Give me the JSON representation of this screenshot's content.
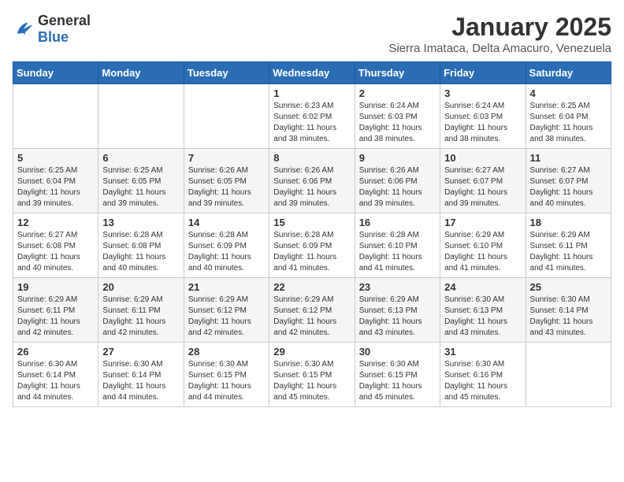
{
  "header": {
    "logo_general": "General",
    "logo_blue": "Blue",
    "title": "January 2025",
    "subtitle": "Sierra Imataca, Delta Amacuro, Venezuela"
  },
  "days_of_week": [
    "Sunday",
    "Monday",
    "Tuesday",
    "Wednesday",
    "Thursday",
    "Friday",
    "Saturday"
  ],
  "weeks": [
    [
      {
        "day": "",
        "info": ""
      },
      {
        "day": "",
        "info": ""
      },
      {
        "day": "",
        "info": ""
      },
      {
        "day": "1",
        "info": "Sunrise: 6:23 AM\nSunset: 6:02 PM\nDaylight: 11 hours and 38 minutes."
      },
      {
        "day": "2",
        "info": "Sunrise: 6:24 AM\nSunset: 6:03 PM\nDaylight: 11 hours and 38 minutes."
      },
      {
        "day": "3",
        "info": "Sunrise: 6:24 AM\nSunset: 6:03 PM\nDaylight: 11 hours and 38 minutes."
      },
      {
        "day": "4",
        "info": "Sunrise: 6:25 AM\nSunset: 6:04 PM\nDaylight: 11 hours and 38 minutes."
      }
    ],
    [
      {
        "day": "5",
        "info": "Sunrise: 6:25 AM\nSunset: 6:04 PM\nDaylight: 11 hours and 39 minutes."
      },
      {
        "day": "6",
        "info": "Sunrise: 6:25 AM\nSunset: 6:05 PM\nDaylight: 11 hours and 39 minutes."
      },
      {
        "day": "7",
        "info": "Sunrise: 6:26 AM\nSunset: 6:05 PM\nDaylight: 11 hours and 39 minutes."
      },
      {
        "day": "8",
        "info": "Sunrise: 6:26 AM\nSunset: 6:06 PM\nDaylight: 11 hours and 39 minutes."
      },
      {
        "day": "9",
        "info": "Sunrise: 6:26 AM\nSunset: 6:06 PM\nDaylight: 11 hours and 39 minutes."
      },
      {
        "day": "10",
        "info": "Sunrise: 6:27 AM\nSunset: 6:07 PM\nDaylight: 11 hours and 39 minutes."
      },
      {
        "day": "11",
        "info": "Sunrise: 6:27 AM\nSunset: 6:07 PM\nDaylight: 11 hours and 40 minutes."
      }
    ],
    [
      {
        "day": "12",
        "info": "Sunrise: 6:27 AM\nSunset: 6:08 PM\nDaylight: 11 hours and 40 minutes."
      },
      {
        "day": "13",
        "info": "Sunrise: 6:28 AM\nSunset: 6:08 PM\nDaylight: 11 hours and 40 minutes."
      },
      {
        "day": "14",
        "info": "Sunrise: 6:28 AM\nSunset: 6:09 PM\nDaylight: 11 hours and 40 minutes."
      },
      {
        "day": "15",
        "info": "Sunrise: 6:28 AM\nSunset: 6:09 PM\nDaylight: 11 hours and 41 minutes."
      },
      {
        "day": "16",
        "info": "Sunrise: 6:28 AM\nSunset: 6:10 PM\nDaylight: 11 hours and 41 minutes."
      },
      {
        "day": "17",
        "info": "Sunrise: 6:29 AM\nSunset: 6:10 PM\nDaylight: 11 hours and 41 minutes."
      },
      {
        "day": "18",
        "info": "Sunrise: 6:29 AM\nSunset: 6:11 PM\nDaylight: 11 hours and 41 minutes."
      }
    ],
    [
      {
        "day": "19",
        "info": "Sunrise: 6:29 AM\nSunset: 6:11 PM\nDaylight: 11 hours and 42 minutes."
      },
      {
        "day": "20",
        "info": "Sunrise: 6:29 AM\nSunset: 6:11 PM\nDaylight: 11 hours and 42 minutes."
      },
      {
        "day": "21",
        "info": "Sunrise: 6:29 AM\nSunset: 6:12 PM\nDaylight: 11 hours and 42 minutes."
      },
      {
        "day": "22",
        "info": "Sunrise: 6:29 AM\nSunset: 6:12 PM\nDaylight: 11 hours and 42 minutes."
      },
      {
        "day": "23",
        "info": "Sunrise: 6:29 AM\nSunset: 6:13 PM\nDaylight: 11 hours and 43 minutes."
      },
      {
        "day": "24",
        "info": "Sunrise: 6:30 AM\nSunset: 6:13 PM\nDaylight: 11 hours and 43 minutes."
      },
      {
        "day": "25",
        "info": "Sunrise: 6:30 AM\nSunset: 6:14 PM\nDaylight: 11 hours and 43 minutes."
      }
    ],
    [
      {
        "day": "26",
        "info": "Sunrise: 6:30 AM\nSunset: 6:14 PM\nDaylight: 11 hours and 44 minutes."
      },
      {
        "day": "27",
        "info": "Sunrise: 6:30 AM\nSunset: 6:14 PM\nDaylight: 11 hours and 44 minutes."
      },
      {
        "day": "28",
        "info": "Sunrise: 6:30 AM\nSunset: 6:15 PM\nDaylight: 11 hours and 44 minutes."
      },
      {
        "day": "29",
        "info": "Sunrise: 6:30 AM\nSunset: 6:15 PM\nDaylight: 11 hours and 45 minutes."
      },
      {
        "day": "30",
        "info": "Sunrise: 6:30 AM\nSunset: 6:15 PM\nDaylight: 11 hours and 45 minutes."
      },
      {
        "day": "31",
        "info": "Sunrise: 6:30 AM\nSunset: 6:16 PM\nDaylight: 11 hours and 45 minutes."
      },
      {
        "day": "",
        "info": ""
      }
    ]
  ]
}
